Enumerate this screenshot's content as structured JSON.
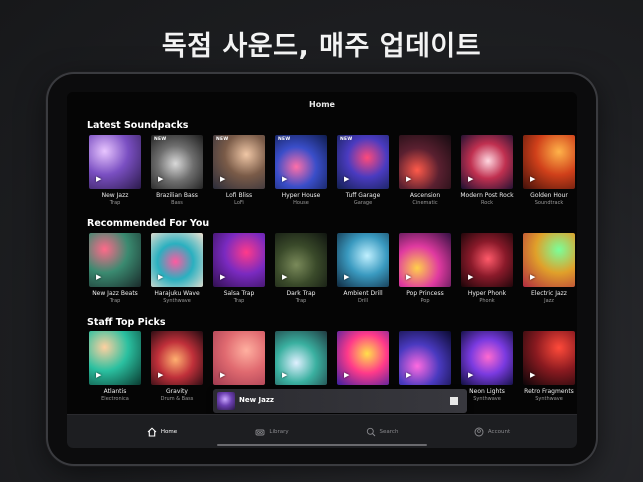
{
  "promo": {
    "headline": "독점 사운드, 매주 업데이트"
  },
  "header": {
    "title": "Home"
  },
  "sections": [
    {
      "title": "Latest Soundpacks",
      "items": [
        {
          "name": "New Jazz",
          "genre": "Trap",
          "badge": "",
          "colors": [
            "#e8c5ff",
            "#7a4fc2",
            "#2b1a4a"
          ]
        },
        {
          "name": "Brazilian Bass",
          "genre": "Bass",
          "badge": "NEW",
          "colors": [
            "#d9d9d9",
            "#6e6e6e",
            "#1c1c1c"
          ]
        },
        {
          "name": "Lofi Bliss",
          "genre": "LoFi",
          "badge": "NEW",
          "colors": [
            "#f0c7a6",
            "#7a5b48",
            "#2a2c3a"
          ]
        },
        {
          "name": "Hyper House",
          "genre": "House",
          "badge": "NEW",
          "colors": [
            "#ff6fa8",
            "#3a4ec9",
            "#0f1c4d"
          ]
        },
        {
          "name": "Tuff Garage",
          "genre": "Garage",
          "badge": "NEW",
          "colors": [
            "#ff4a7a",
            "#4a3bc0",
            "#122050"
          ]
        },
        {
          "name": "Ascension",
          "genre": "Cinematic",
          "badge": "",
          "colors": [
            "#ff5a4a",
            "#5a2030",
            "#150b10"
          ]
        },
        {
          "name": "Modern Post Rock",
          "genre": "Rock",
          "badge": "",
          "colors": [
            "#ffd7e0",
            "#c03050",
            "#1a1030"
          ]
        },
        {
          "name": "Golden Hour",
          "genre": "Soundtrack",
          "badge": "",
          "colors": [
            "#ffb34a",
            "#d0401a",
            "#40100a"
          ]
        }
      ]
    },
    {
      "title": "Recommended For You",
      "items": [
        {
          "name": "New Jazz Beats",
          "genre": "Trap",
          "badge": "",
          "colors": [
            "#ff6a8a",
            "#3a8a70",
            "#1a2a2a"
          ]
        },
        {
          "name": "Harajuku Wave",
          "genre": "Synthwave",
          "badge": "",
          "colors": [
            "#ff5aa0",
            "#2ab0c0",
            "#f0e0d0"
          ]
        },
        {
          "name": "Salsa Trap",
          "genre": "Trap",
          "badge": "",
          "colors": [
            "#ff3a8a",
            "#7a2ac0",
            "#301050"
          ]
        },
        {
          "name": "Dark Trap",
          "genre": "Trap",
          "badge": "",
          "colors": [
            "#7a8a5a",
            "#3a4a2a",
            "#101510"
          ]
        },
        {
          "name": "Ambient Drill",
          "genre": "Drill",
          "badge": "",
          "colors": [
            "#c0f0ff",
            "#3a9ac0",
            "#102a40"
          ]
        },
        {
          "name": "Pop Princess",
          "genre": "Pop",
          "badge": "",
          "colors": [
            "#ffd04a",
            "#e03aa0",
            "#301040"
          ]
        },
        {
          "name": "Hyper Phonk",
          "genre": "Phonk",
          "badge": "",
          "colors": [
            "#ff5a6a",
            "#8a1a2a",
            "#1a0508"
          ]
        },
        {
          "name": "Electric Jazz",
          "genre": "Jazz",
          "badge": "",
          "colors": [
            "#7aff9a",
            "#e0a02a",
            "#b02a40"
          ]
        }
      ]
    },
    {
      "title": "Staff Top Picks",
      "items": [
        {
          "name": "Atlantis",
          "genre": "Electronica",
          "badge": "",
          "colors": [
            "#ffd0a0",
            "#2ac0a0",
            "#0a3a30"
          ]
        },
        {
          "name": "Gravity",
          "genre": "Drum & Bass",
          "badge": "",
          "colors": [
            "#ffb070",
            "#c0303a",
            "#200a10"
          ]
        },
        {
          "name": "",
          "genre": "",
          "badge": "",
          "colors": [
            "#ffb0a0",
            "#e06a70",
            "#a03a50"
          ]
        },
        {
          "name": "",
          "genre": "",
          "badge": "",
          "colors": [
            "#e0f0ff",
            "#3ab0a0",
            "#203a40"
          ]
        },
        {
          "name": "",
          "genre": "",
          "badge": "",
          "colors": [
            "#ffe04a",
            "#ff3a8a",
            "#3a20a0"
          ]
        },
        {
          "name": "",
          "genre": "",
          "badge": "",
          "colors": [
            "#ff6ae0",
            "#4a3ac0",
            "#0a0a30"
          ]
        },
        {
          "name": "Neon Lights",
          "genre": "Synthwave",
          "badge": "",
          "colors": [
            "#ff6ad0",
            "#7a3ae0",
            "#101040"
          ]
        },
        {
          "name": "Retro Fragments",
          "genre": "Synthwave",
          "badge": "",
          "colors": [
            "#ff4a3a",
            "#8a1a20",
            "#0a0508"
          ]
        }
      ]
    }
  ],
  "mini_player": {
    "title": "New Jazz",
    "play_icon": "stop-icon"
  },
  "tabs": [
    {
      "label": "Home",
      "icon": "home-icon",
      "active": true
    },
    {
      "label": "Library",
      "icon": "library-icon",
      "active": false
    },
    {
      "label": "Search",
      "icon": "search-icon",
      "active": false
    },
    {
      "label": "Account",
      "icon": "account-icon",
      "active": false
    }
  ],
  "colors": {
    "background": "#1e1f22",
    "screen": "#050505",
    "accent": "#ffffff"
  }
}
